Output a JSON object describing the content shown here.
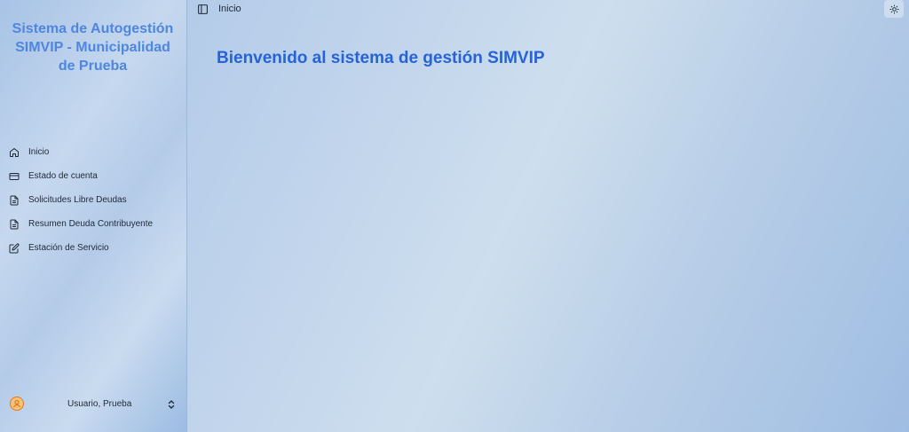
{
  "sidebar": {
    "brand": "Sistema de Autogestión SIMVIP - Municipalidad de Prueba",
    "items": [
      {
        "label": "Inicio",
        "icon": "home-icon"
      },
      {
        "label": "Estado de cuenta",
        "icon": "credit-card-icon"
      },
      {
        "label": "Solicitudes Libre Deudas",
        "icon": "file-text-icon"
      },
      {
        "label": "Resumen Deuda Contribuyente",
        "icon": "file-text-icon"
      },
      {
        "label": "Estación de Servicio",
        "icon": "edit-icon"
      }
    ],
    "user": {
      "name": "Usuario, Prueba",
      "avatar_color": "#e07b1a"
    }
  },
  "header": {
    "breadcrumb": "Inicio"
  },
  "main": {
    "welcome": "Bienvenido al sistema de gestión SIMVIP",
    "accent_color": "#2663d9"
  }
}
